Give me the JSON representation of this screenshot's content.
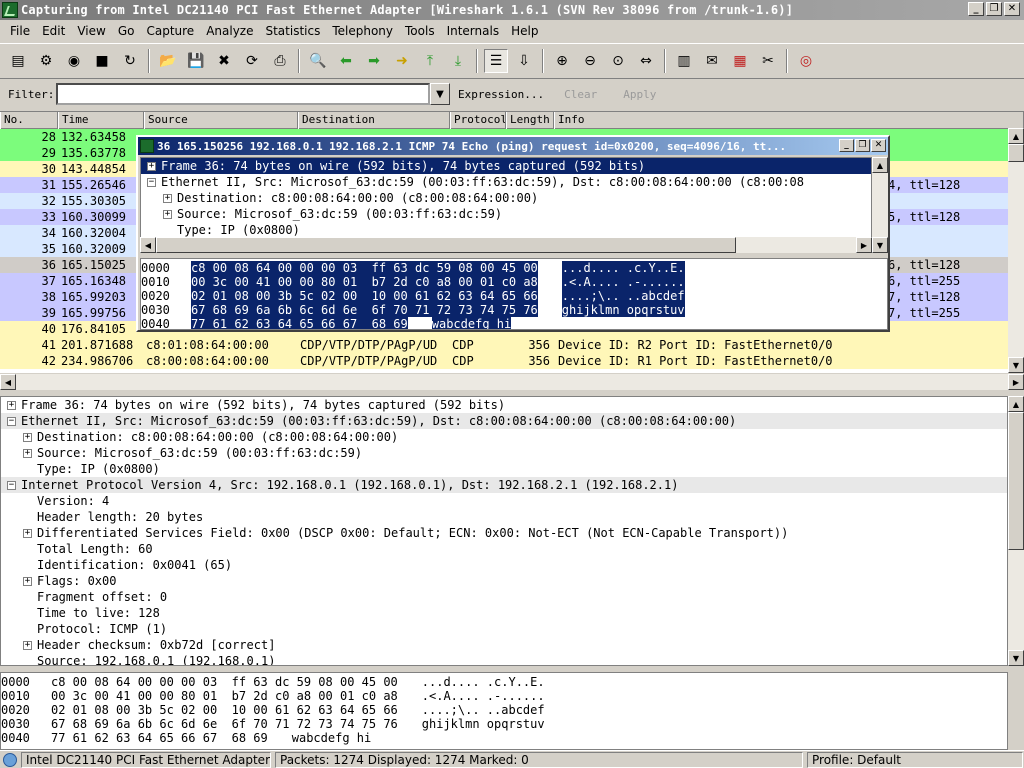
{
  "window": {
    "title": "Capturing from Intel DC21140 PCI Fast Ethernet Adapter    [Wireshark 1.6.1  (SVN Rev 38096 from /trunk-1.6)]",
    "minimize": "_",
    "maximize": "❐",
    "close": "✕"
  },
  "menu": [
    "File",
    "Edit",
    "View",
    "Go",
    "Capture",
    "Analyze",
    "Statistics",
    "Telephony",
    "Tools",
    "Internals",
    "Help"
  ],
  "filter": {
    "label": "Filter:",
    "value": "",
    "expression": "Expression...",
    "clear": "Clear",
    "apply": "Apply"
  },
  "columns": [
    "No.",
    "Time",
    "Source",
    "Destination",
    "Protocol",
    "Length",
    "Info"
  ],
  "colors": {
    "green": "#7cfc7c",
    "pale_green": "#b4f8b4",
    "yellow": "#fff7b8",
    "lavender": "#c8c8ff",
    "light_blue": "#d8e8ff",
    "gray": "#d0ccc8",
    "select": "#0a246a"
  },
  "packets": [
    {
      "no": "28",
      "time": "132.63458",
      "src": "",
      "dst": "",
      "proto": "",
      "len": "",
      "info": "",
      "info_right": "",
      "bg": "#7cfc7c"
    },
    {
      "no": "29",
      "time": "135.63778",
      "src": "",
      "dst": "",
      "proto": "",
      "len": "",
      "info": "",
      "info_right": "",
      "bg": "#7cfc7c"
    },
    {
      "no": "30",
      "time": "143.44854",
      "src": "",
      "dst": "",
      "proto": "",
      "len": "",
      "info": "",
      "info_right": "",
      "bg": "#fff7b8"
    },
    {
      "no": "31",
      "time": "155.26546",
      "src": "",
      "dst": "",
      "proto": "",
      "len": "",
      "info": "",
      "info_right": "4, ttl=128",
      "bg": "#c8c8ff"
    },
    {
      "no": "32",
      "time": "155.30305",
      "src": "",
      "dst": "",
      "proto": "",
      "len": "",
      "info": "",
      "info_right": "",
      "bg": "#d8e8ff"
    },
    {
      "no": "33",
      "time": "160.30099",
      "src": "",
      "dst": "",
      "proto": "",
      "len": "",
      "info": "",
      "info_right": "5, ttl=128",
      "bg": "#c8c8ff"
    },
    {
      "no": "34",
      "time": "160.32004",
      "src": "",
      "dst": "",
      "proto": "",
      "len": "",
      "info": "",
      "info_right": "",
      "bg": "#d8e8ff"
    },
    {
      "no": "35",
      "time": "160.32009",
      "src": "",
      "dst": "",
      "proto": "",
      "len": "",
      "info": "",
      "info_right": "",
      "bg": "#d8e8ff"
    },
    {
      "no": "36",
      "time": "165.15025",
      "src": "",
      "dst": "",
      "proto": "",
      "len": "",
      "info": "",
      "info_right": "6, ttl=128",
      "bg": "#d0ccc8"
    },
    {
      "no": "37",
      "time": "165.16348",
      "src": "",
      "dst": "",
      "proto": "",
      "len": "",
      "info": "",
      "info_right": "6, ttl=255",
      "bg": "#c8c8ff"
    },
    {
      "no": "38",
      "time": "165.99203",
      "src": "",
      "dst": "",
      "proto": "",
      "len": "",
      "info": "",
      "info_right": "7, ttl=128",
      "bg": "#c8c8ff"
    },
    {
      "no": "39",
      "time": "165.99756",
      "src": "",
      "dst": "",
      "proto": "",
      "len": "",
      "info": "",
      "info_right": "7, ttl=255",
      "bg": "#c8c8ff"
    },
    {
      "no": "40",
      "time": "176.84105",
      "src": "",
      "dst": "",
      "proto": "",
      "len": "",
      "info": "",
      "info_right": "",
      "bg": "#fff7b8"
    },
    {
      "no": "41",
      "time": "201.871688",
      "src": "c8:01:08:64:00:00",
      "dst": "CDP/VTP/DTP/PAgP/UD",
      "proto": "CDP",
      "len": "356",
      "info": "Device ID: R2   Port ID: FastEthernet0/0",
      "info_right": "",
      "bg": "#fff7b8"
    },
    {
      "no": "42",
      "time": "234.986706",
      "src": "c8:00:08:64:00:00",
      "dst": "CDP/VTP/DTP/PAgP/UD",
      "proto": "CDP",
      "len": "356",
      "info": "Device ID: R1   Port ID: FastEthernet0/0",
      "info_right": "",
      "bg": "#fff7b8"
    }
  ],
  "details": [
    {
      "text": "Frame 36: 74 bytes on wire (592 bits), 74 bytes captured (592 bits)",
      "indent": 0,
      "exp": "+",
      "hl": false
    },
    {
      "text": "Ethernet II, Src: Microsof_63:dc:59 (00:03:ff:63:dc:59), Dst: c8:00:08:64:00:00 (c8:00:08:64:00:00)",
      "indent": 0,
      "exp": "−",
      "hl": true
    },
    {
      "text": "Destination: c8:00:08:64:00:00 (c8:00:08:64:00:00)",
      "indent": 1,
      "exp": "+",
      "hl": false
    },
    {
      "text": "Source: Microsof_63:dc:59 (00:03:ff:63:dc:59)",
      "indent": 1,
      "exp": "+",
      "hl": false
    },
    {
      "text": "Type: IP (0x0800)",
      "indent": 1,
      "exp": "",
      "hl": false
    },
    {
      "text": "Internet Protocol Version 4, Src: 192.168.0.1 (192.168.0.1), Dst: 192.168.2.1 (192.168.2.1)",
      "indent": 0,
      "exp": "−",
      "hl": true
    },
    {
      "text": "Version: 4",
      "indent": 1,
      "exp": "",
      "hl": false
    },
    {
      "text": "Header length: 20 bytes",
      "indent": 1,
      "exp": "",
      "hl": false
    },
    {
      "text": "Differentiated Services Field: 0x00 (DSCP 0x00: Default; ECN: 0x00: Not-ECT (Not ECN-Capable Transport))",
      "indent": 1,
      "exp": "+",
      "hl": false
    },
    {
      "text": "Total Length: 60",
      "indent": 1,
      "exp": "",
      "hl": false
    },
    {
      "text": "Identification: 0x0041 (65)",
      "indent": 1,
      "exp": "",
      "hl": false
    },
    {
      "text": "Flags: 0x00",
      "indent": 1,
      "exp": "+",
      "hl": false
    },
    {
      "text": "Fragment offset: 0",
      "indent": 1,
      "exp": "",
      "hl": false
    },
    {
      "text": "Time to live: 128",
      "indent": 1,
      "exp": "",
      "hl": false
    },
    {
      "text": "Protocol: ICMP (1)",
      "indent": 1,
      "exp": "",
      "hl": false
    },
    {
      "text": "Header checksum: 0xb72d [correct]",
      "indent": 1,
      "exp": "+",
      "hl": false
    },
    {
      "text": "Source: 192.168.0.1 (192.168.0.1)",
      "indent": 1,
      "exp": "",
      "hl": false
    }
  ],
  "hex": [
    {
      "offset": "0000",
      "bytes": "c8 00 08 64 00 00 00 03  ff 63 dc 59 08 00 45 00",
      "ascii": "...d.... .c.Y..E."
    },
    {
      "offset": "0010",
      "bytes": "00 3c 00 41 00 00 80 01  b7 2d c0 a8 00 01 c0 a8",
      "ascii": ".<.A.... .-......"
    },
    {
      "offset": "0020",
      "bytes": "02 01 08 00 3b 5c 02 00  10 00 61 62 63 64 65 66",
      "ascii": "....;\\.. ..abcdef"
    },
    {
      "offset": "0030",
      "bytes": "67 68 69 6a 6b 6c 6d 6e  6f 70 71 72 73 74 75 76",
      "ascii": "ghijklmn opqrstuv"
    },
    {
      "offset": "0040",
      "bytes": "77 61 62 63 64 65 66 67  68 69",
      "ascii": "wabcdefg hi"
    }
  ],
  "popup": {
    "title": "36 165.150256 192.168.0.1 192.168.2.1 ICMP 74 Echo (ping) request  id=0x0200, seq=4096/16, tt...",
    "tree": [
      {
        "text": "Frame 36: 74 bytes on wire (592 bits), 74 bytes captured (592 bits)",
        "indent": 0,
        "exp": "+",
        "sel": true
      },
      {
        "text": "Ethernet II, Src: Microsof_63:dc:59 (00:03:ff:63:dc:59), Dst: c8:00:08:64:00:00 (c8:00:08",
        "indent": 0,
        "exp": "−",
        "sel": false
      },
      {
        "text": "Destination: c8:00:08:64:00:00 (c8:00:08:64:00:00)",
        "indent": 1,
        "exp": "+",
        "sel": false
      },
      {
        "text": "Source: Microsof_63:dc:59 (00:03:ff:63:dc:59)",
        "indent": 1,
        "exp": "+",
        "sel": false
      },
      {
        "text": "Type: IP (0x0800)",
        "indent": 1,
        "exp": "",
        "sel": false
      }
    ]
  },
  "status": {
    "interface": "Intel DC21140 PCI Fast Ethernet Adapter...",
    "packets": "Packets: 1274 Displayed: 1274 Marked: 0",
    "profile": "Profile: Default"
  }
}
